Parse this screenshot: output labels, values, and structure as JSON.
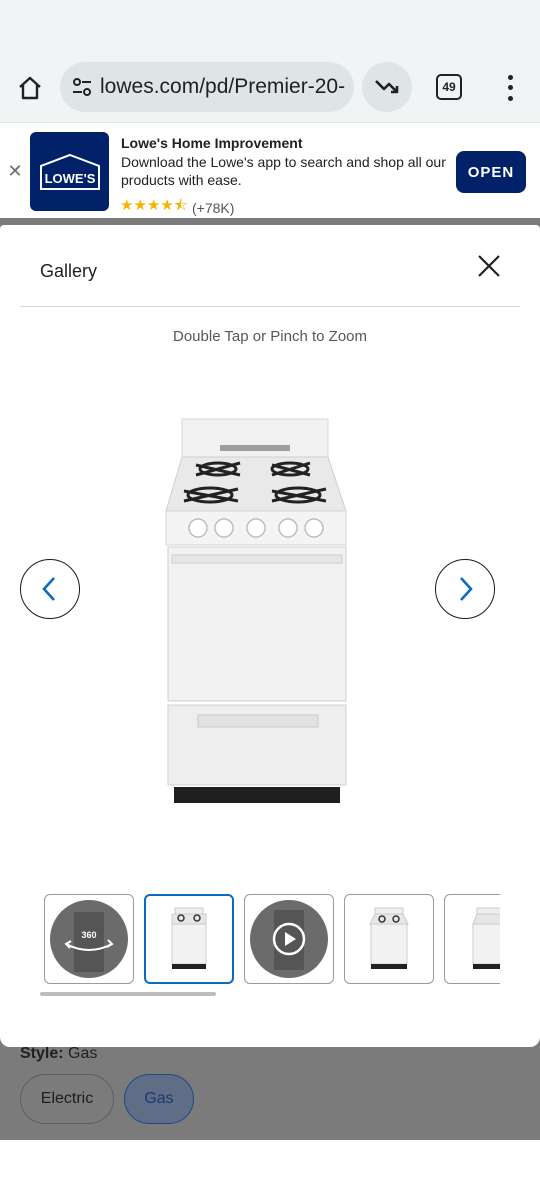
{
  "browser": {
    "url": "lowes.com/pd/Premier-20-",
    "tab_count": "49"
  },
  "app_banner": {
    "title": "Lowe's Home Improvement",
    "description": "Download the Lowe's app to search and shop all our products with ease.",
    "logo_text": "LOWE'S",
    "rating_stars": "★★★★⯪",
    "rating_count": "(+78K)",
    "open_label": "OPEN",
    "close_glyph": "✕"
  },
  "gallery": {
    "title": "Gallery",
    "zoom_hint": "Double Tap or Pinch to Zoom",
    "thumbnails": [
      {
        "type": "360",
        "label": "360"
      },
      {
        "type": "image",
        "selected": true
      },
      {
        "type": "video"
      },
      {
        "type": "image"
      },
      {
        "type": "image"
      }
    ]
  },
  "page_behind": {
    "style_label": "Style:",
    "style_value": "Gas",
    "options": [
      "Electric",
      "Gas"
    ]
  },
  "colors": {
    "lowes_blue": "#012169",
    "selected_thumb": "#0b6bc2",
    "arrow_blue": "#0b6bc2",
    "star_gold": "#f4b400"
  }
}
